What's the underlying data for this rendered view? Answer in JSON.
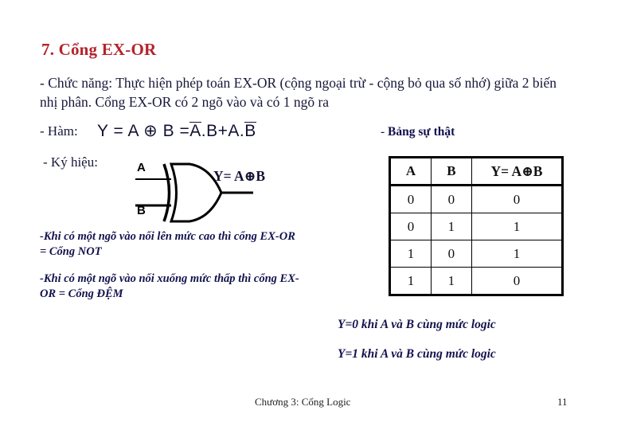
{
  "slide": {
    "title": "7. Cổng EX-OR",
    "title_color": "#b5232b",
    "background_color": "#ffffff",
    "body_color": "#17173a",
    "accent_color": "#12124e"
  },
  "intro": {
    "text": "- Chức năng: Thực hiện phép toán EX-OR (cộng ngoại trừ - cộng bỏ qua số nhớ) giữa 2 biến nhị phân. Cổng EX-OR có 2 ngõ vào và có 1 ngõ ra"
  },
  "function_section": {
    "label": "- Hàm:",
    "formula_parts": {
      "y": "Y",
      "eq1": "=",
      "a": "A",
      "xor": "⊕",
      "b": "B",
      "eq2": "=",
      "a_bar": "A",
      "dot1": ".",
      "b_plain": "B",
      "plus": "+",
      "a_plain": "A",
      "dot2": ".",
      "b_bar": "B"
    },
    "formula_plain": "Y = A ⊕ B = Ā.B + A.B̄"
  },
  "symbol_section": {
    "label": "- Ký hiệu:",
    "gate_type": "xor-gate",
    "input_a_label": "A",
    "input_b_label": "B",
    "output_equation": "Y= A⊕B"
  },
  "notes": [
    {
      "line1": "-Khi có một ngõ vào nối lên mức cao thì",
      "line2": "cổng EX-OR = Cổng NOT"
    },
    {
      "line1": "-Khi có một ngõ vào nối xuống mức thấp",
      "line2": "thì cổng EX-OR = Cổng ĐỆM"
    }
  ],
  "truth_table": {
    "label": "- Bảng sự thật",
    "label_dash": "- ",
    "label_text": "Bảng sự thật",
    "headers": [
      "A",
      "B",
      "Y= A⊕B"
    ],
    "rows": [
      [
        "0",
        "0",
        "0"
      ],
      [
        "0",
        "1",
        "1"
      ],
      [
        "1",
        "0",
        "1"
      ],
      [
        "1",
        "1",
        "0"
      ]
    ]
  },
  "conclusions": [
    "Y=0 khi A và B cùng mức logic",
    "Y=1 khi A và B cùng mức logic"
  ],
  "footer": {
    "chapter": "Chương 3: Cổng Logic",
    "page_number": "11"
  }
}
